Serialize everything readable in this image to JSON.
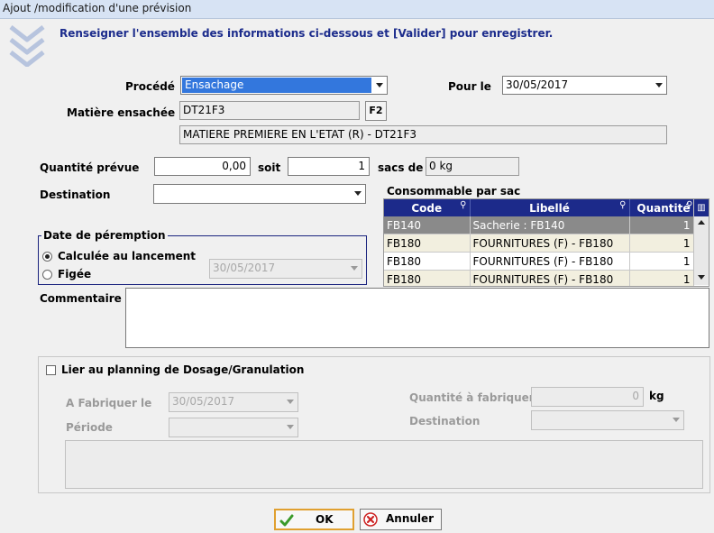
{
  "window": {
    "title": "Ajout /modification d'une prévision"
  },
  "header": {
    "instruction": "Renseigner l'ensemble des informations ci-dessous et [Valider] pour enregistrer."
  },
  "form": {
    "procede": {
      "label": "Procédé",
      "value": "Ensachage"
    },
    "pour_le": {
      "label": "Pour le",
      "value": "30/05/2017"
    },
    "matiere": {
      "label": "Matière ensachée",
      "code": "DT21F3",
      "f2_label": "F2",
      "description": "MATIERE PREMIERE EN L'ETAT (R) - DT21F3"
    },
    "quantite": {
      "label": "Quantité prévue",
      "value": "0,00",
      "soit_label": "soit",
      "sacs": "1",
      "sacs_label": "sacs de",
      "weight": "0 kg"
    },
    "destination": {
      "label": "Destination",
      "value": ""
    },
    "peremption": {
      "title": "Date de péremption",
      "option_calculee": "Calculée au lancement",
      "option_figee": "Figée",
      "date": "30/05/2017",
      "selected": "calculee"
    },
    "commentaire": {
      "label": "Commentaire",
      "value": ""
    }
  },
  "consommable": {
    "title": "Consommable par sac",
    "columns": [
      "Code",
      "Libellé",
      "Quantité"
    ],
    "rows": [
      {
        "code": "FB140",
        "libelle": "Sacherie : FB140",
        "quantite": "1"
      },
      {
        "code": "FB180",
        "libelle": "FOURNITURES (F) - FB180",
        "quantite": "1"
      },
      {
        "code": "FB180",
        "libelle": "FOURNITURES (F) - FB180",
        "quantite": "1"
      },
      {
        "code": "FB180",
        "libelle": "FOURNITURES (F) - FB180",
        "quantite": "1"
      }
    ]
  },
  "planning": {
    "checkbox_label": "Lier au planning de Dosage/Granulation",
    "checked": false,
    "fabriquer_le": {
      "label": "A Fabriquer le",
      "value": "30/05/2017"
    },
    "periode": {
      "label": "Période",
      "value": ""
    },
    "quantite": {
      "label": "Quantité à fabriquer",
      "value": "0",
      "unit": "kg"
    },
    "destination": {
      "label": "Destination",
      "value": ""
    }
  },
  "buttons": {
    "ok": "OK",
    "annuler": "Annuler"
  },
  "colors": {
    "accent": "#1c2a8a",
    "selection": "#3377dd",
    "default_border": "#e0a030"
  }
}
